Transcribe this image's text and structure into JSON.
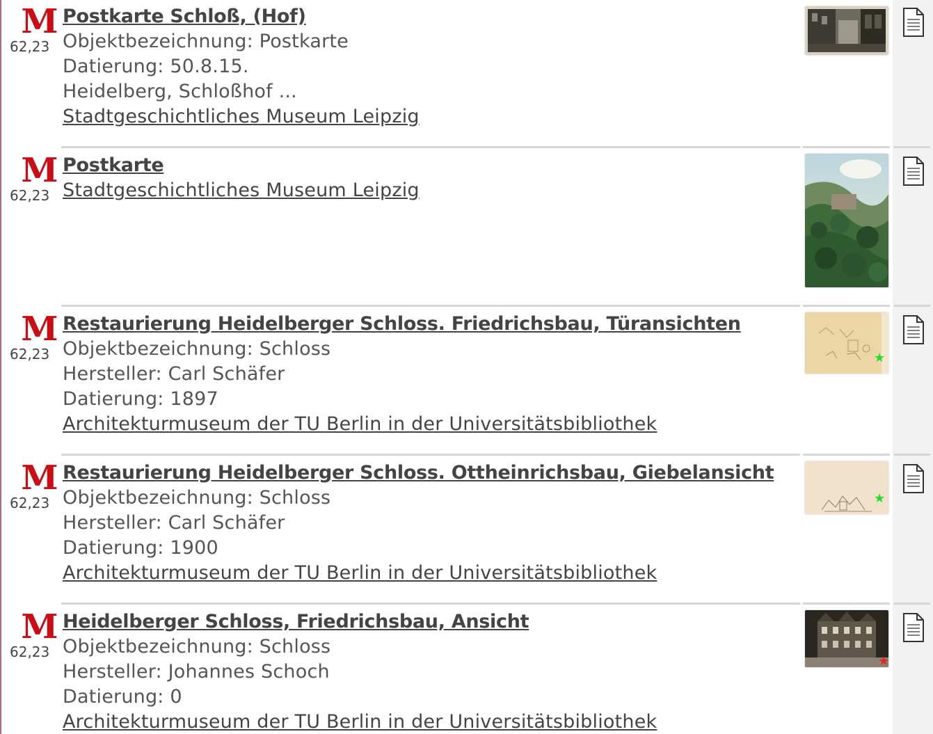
{
  "results": [
    {
      "logo": "M",
      "score": "62,23",
      "title": "Postkarte Schloß, (Hof)",
      "lines": [
        "Objektbezeichnung: Postkarte",
        "Datierung: 50.8.15.",
        "Heidelberg, Schloßhof ..."
      ],
      "institution": "Stadtgeschichtliches Museum Leipzig",
      "thumb_icon": "postcard-photo-thumbnail"
    },
    {
      "logo": "M",
      "score": "62,23",
      "title": "Postkarte",
      "lines": [],
      "institution": "Stadtgeschichtliches Museum Leipzig",
      "thumb_icon": "postcard-forest-thumbnail"
    },
    {
      "logo": "M",
      "score": "62,23",
      "title": "Restaurierung Heidelberger Schloss. Friedrichsbau, Türansichten",
      "lines": [
        "Objektbezeichnung: Schloss",
        "Hersteller: Carl Schäfer",
        "Datierung: 1897"
      ],
      "institution": "Architekturmuseum der TU Berlin in der Universitätsbibliothek",
      "thumb_icon": "drawing-thumbnail"
    },
    {
      "logo": "M",
      "score": "62,23",
      "title": "Restaurierung Heidelberger Schloss. Ottheinrichsbau, Giebelansicht",
      "lines": [
        "Objektbezeichnung: Schloss",
        "Hersteller: Carl Schäfer",
        "Datierung: 1900"
      ],
      "institution": "Architekturmuseum der TU Berlin in der Universitätsbibliothek",
      "thumb_icon": "drawing-thumbnail"
    },
    {
      "logo": "M",
      "score": "62,23",
      "title": "Heidelberger Schloss, Friedrichsbau, Ansicht",
      "lines": [
        "Objektbezeichnung: Schloss",
        "Hersteller: Johannes Schoch",
        "Datierung: 0"
      ],
      "institution": "Architekturmuseum der TU Berlin in der Universitätsbibliothek",
      "thumb_icon": "photo-thumbnail"
    }
  ],
  "colors": {
    "logo_red": "#cc0c14",
    "text": "#555555",
    "link": "#444444",
    "separator": "#d6d6d6",
    "right_column": "#f1f1f1",
    "star_green": "#22dd22",
    "star_red": "#ee2222"
  },
  "icons": {
    "document": "document-icon",
    "star": "star-icon"
  }
}
